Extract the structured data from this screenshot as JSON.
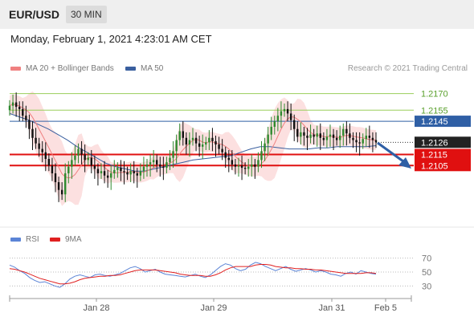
{
  "header": {
    "symbol": "EUR/USD",
    "timeframe": "30 MIN"
  },
  "timestamp": "Monday, February 1, 2021 4:23:01 AM CET",
  "legend": [
    {
      "label": "MA 20 + Bollinger Bands",
      "color": "#f08080"
    },
    {
      "label": "MA 50",
      "color": "#3a5f9f"
    }
  ],
  "credit": "Research © 2021 Trading Central",
  "rsi_legend": [
    {
      "label": "RSI",
      "color": "#5b84d6"
    },
    {
      "label": "9MA",
      "color": "#e02020"
    }
  ],
  "colors": {
    "up": "#2f8a2f",
    "down": "#111111",
    "band": "#fbd8d8",
    "ma20": "#f08080",
    "ma50": "#3a5f9f",
    "resistance": "#9acd5a",
    "pivot": "#2f5fa5",
    "support": "#e01010",
    "arrow": "#2f5fa5"
  },
  "chart_data": [
    {
      "type": "line",
      "title": "EUR/USD 30 MIN",
      "x_ticks": [
        "Jan 28",
        "Jan 29",
        "Jan 31",
        "Feb 5"
      ],
      "ylim": [
        1.2048,
        1.2182
      ],
      "levels": [
        {
          "value": 1.217,
          "label": "1.2170",
          "kind": "resistance"
        },
        {
          "value": 1.2155,
          "label": "1.2155",
          "kind": "resistance"
        },
        {
          "value": 1.2145,
          "label": "1.2145",
          "kind": "pivot"
        },
        {
          "value": 1.2126,
          "label": "1.2126",
          "kind": "last"
        },
        {
          "value": 1.2115,
          "label": "1.2115",
          "kind": "support"
        },
        {
          "value": 1.2105,
          "label": "1.2105",
          "kind": "support"
        }
      ],
      "close_series": [
        1.2159,
        1.2162,
        1.2158,
        1.2156,
        1.215,
        1.2146,
        1.2138,
        1.213,
        1.2125,
        1.212,
        1.2117,
        1.2111,
        1.2105,
        1.2098,
        1.209,
        1.2083,
        1.2079,
        1.2098,
        1.2104,
        1.211,
        1.2114,
        1.212,
        1.2115,
        1.211,
        1.2112,
        1.2105,
        1.2102,
        1.2098,
        1.21,
        1.2096,
        1.2094,
        1.2098,
        1.2101,
        1.2103,
        1.21,
        1.2099,
        1.2097,
        1.21,
        1.2098,
        1.2096,
        1.21,
        1.2104,
        1.2106,
        1.2108,
        1.211,
        1.2106,
        1.2104,
        1.2103,
        1.2108,
        1.2112,
        1.2118,
        1.2128,
        1.2136,
        1.213,
        1.2124,
        1.2128,
        1.213,
        1.2125,
        1.2122,
        1.2124,
        1.2126,
        1.213,
        1.2127,
        1.2124,
        1.212,
        1.2117,
        1.2112,
        1.211,
        1.2106,
        1.2104,
        1.2105,
        1.2103,
        1.2102,
        1.2104,
        1.2106,
        1.2104,
        1.211,
        1.2118,
        1.2125,
        1.2133,
        1.214,
        1.2145,
        1.215,
        1.2154,
        1.2156,
        1.2152,
        1.2146,
        1.2138,
        1.2131,
        1.2135,
        1.2132,
        1.213,
        1.2133,
        1.2131,
        1.2134,
        1.213,
        1.2128,
        1.2131,
        1.2133,
        1.213,
        1.2128,
        1.2132,
        1.2138,
        1.2134,
        1.213,
        1.2128,
        1.2126,
        1.2125,
        1.2129,
        1.2132,
        1.213,
        1.2128,
        1.2126
      ],
      "ma50_series": [
        1.2152,
        1.2149,
        1.2146,
        1.2142,
        1.2138,
        1.2133,
        1.2128,
        1.2122,
        1.2117,
        1.2112,
        1.2107,
        1.2104,
        1.2102,
        1.21,
        1.21,
        1.2102,
        1.2104,
        1.2106,
        1.2108,
        1.211,
        1.2111,
        1.2112,
        1.2113,
        1.2114,
        1.2117,
        1.212,
        1.2122,
        1.2122,
        1.2121,
        1.212,
        1.212,
        1.212,
        1.2121,
        1.2121,
        1.2122,
        1.2122,
        1.2122,
        1.2122,
        1.2123
      ]
    },
    {
      "type": "line",
      "title": "RSI",
      "yticks": [
        70,
        50,
        30
      ],
      "ylim": [
        20,
        80
      ],
      "series": [
        {
          "name": "RSI",
          "values": [
            60,
            57,
            52,
            48,
            42,
            38,
            35,
            36,
            33,
            30,
            28,
            33,
            40,
            44,
            46,
            44,
            42,
            46,
            47,
            45,
            44,
            46,
            48,
            52,
            56,
            58,
            55,
            50,
            52,
            54,
            50,
            47,
            46,
            45,
            44,
            43,
            45,
            47,
            44,
            42,
            46,
            52,
            58,
            62,
            60,
            55,
            52,
            54,
            60,
            64,
            62,
            58,
            55,
            52,
            55,
            58,
            54,
            51,
            53,
            55,
            53,
            50,
            52,
            50,
            47,
            46,
            44,
            48,
            50,
            47,
            52,
            50,
            48,
            47
          ]
        },
        {
          "name": "9MA",
          "values": [
            55,
            54,
            52,
            50,
            47,
            44,
            41,
            39,
            37,
            35,
            33,
            33,
            34,
            36,
            39,
            41,
            42,
            43,
            44,
            44,
            45,
            45,
            46,
            48,
            50,
            52,
            53,
            53,
            53,
            53,
            52,
            51,
            50,
            49,
            47,
            46,
            45,
            45,
            45,
            44,
            44,
            46,
            49,
            53,
            56,
            58,
            58,
            58,
            58,
            60,
            61,
            61,
            60,
            58,
            57,
            56,
            56,
            55,
            55,
            54,
            54,
            53,
            53,
            52,
            51,
            50,
            49,
            48,
            48,
            48,
            48,
            49,
            49,
            48
          ]
        }
      ]
    }
  ]
}
